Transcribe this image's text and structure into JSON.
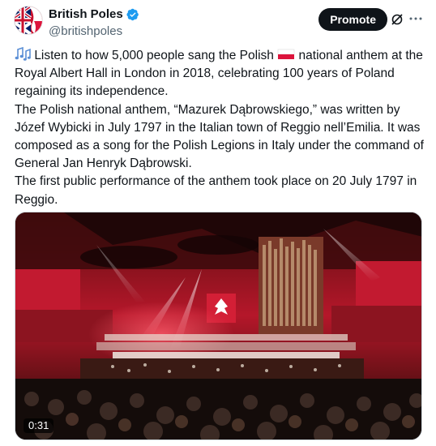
{
  "tweet": {
    "author": {
      "display_name": "British Poles",
      "handle": "@britishpoles",
      "verified": true
    },
    "actions": {
      "promote_label": "Promote",
      "grok_icon": "grok-icon",
      "more_icon": "more-dots-icon"
    },
    "text": {
      "p1_before_flag": "Listen to how 5,000 people sang the Polish",
      "p1_after_flag": "national anthem at the Royal Albert Hall in London in 2018, celebrating 100 years of Poland regaining its independence.",
      "p2": "The Polish national anthem, “Mazurek Dąbrowskiego,” was written by Józef Wybicki in July 1797 in the Italian town of Reggio nell’Emilia. It was composed as a song for the Polish Legions in Italy under the command of General Jan Henryk Dąbrowski.",
      "p3": "The first public performance of the anthem took place on 20 July 1797 in Reggio."
    },
    "emojis": {
      "music_notes": "music-notes-emoji",
      "flag": "poland-flag-emoji"
    },
    "media": {
      "type": "video",
      "duration": "0:31"
    },
    "colors": {
      "accent_verified": "#1d9bf0",
      "text_primary": "#0f1419",
      "text_secondary": "#536471",
      "promote_bg": "#0f1419"
    }
  }
}
